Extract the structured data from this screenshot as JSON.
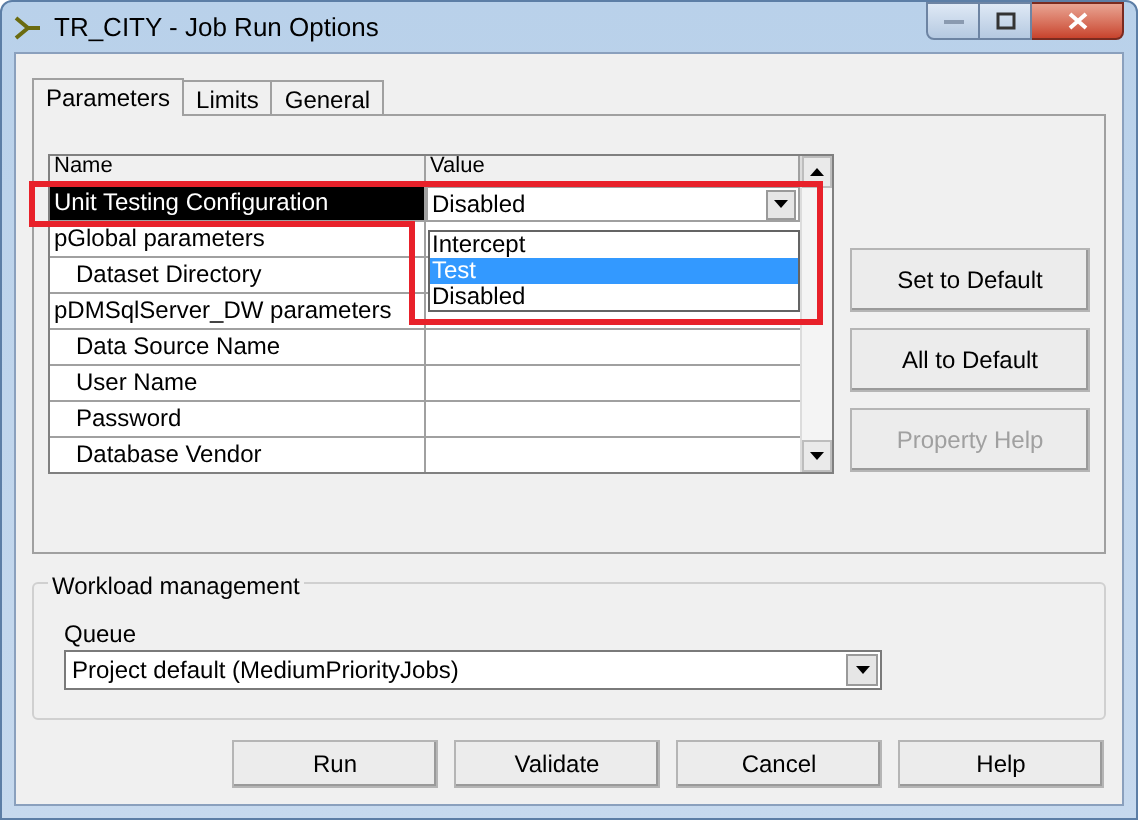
{
  "window": {
    "title": "TR_CITY - Job Run Options"
  },
  "tabs": [
    {
      "label": "Parameters",
      "selected": true
    },
    {
      "label": "Limits",
      "selected": false
    },
    {
      "label": "General",
      "selected": false
    }
  ],
  "grid": {
    "columns": [
      "Name",
      "Value"
    ],
    "rows": [
      {
        "name": "Unit Testing Configuration",
        "value": "Disabled",
        "selected": true,
        "editing": true
      },
      {
        "name": "pGlobal parameters",
        "selected": false,
        "children": [
          {
            "name": "Dataset Directory",
            "selected": false
          }
        ]
      },
      {
        "name": "pDMSqlServer_DW parameters",
        "selected": false,
        "children": [
          {
            "name": "Data Source Name",
            "selected": false
          },
          {
            "name": "User Name",
            "selected": false
          },
          {
            "name": "Password",
            "selected": false
          },
          {
            "name": "Database Vendor",
            "selected": false
          }
        ]
      }
    ],
    "dropdown_options": [
      {
        "label": "Intercept",
        "selected": false
      },
      {
        "label": "Test",
        "selected": true
      },
      {
        "label": "Disabled",
        "selected": false
      }
    ]
  },
  "side_buttons": [
    {
      "label": "Set to Default",
      "disabled": false
    },
    {
      "label": "All to Default",
      "disabled": false
    },
    {
      "label": "Property Help",
      "disabled": true
    }
  ],
  "workload": {
    "title": "Workload management",
    "queue_label": "Queue",
    "queue_value": "Project default (MediumPriorityJobs)"
  },
  "buttons": [
    "Run",
    "Validate",
    "Cancel",
    "Help"
  ]
}
